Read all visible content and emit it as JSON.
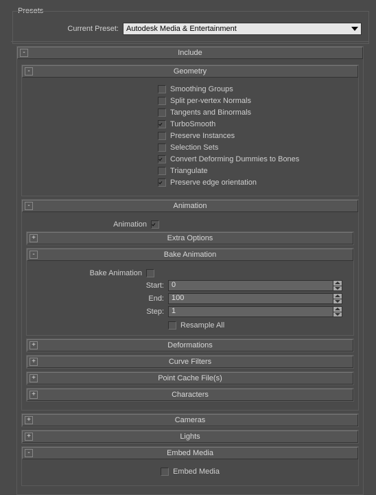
{
  "presets": {
    "legend": "Presets",
    "label": "Current Preset:",
    "value": "Autodesk Media & Entertainment"
  },
  "include": {
    "title": "Include",
    "geometry": {
      "title": "Geometry",
      "options": [
        {
          "label": "Smoothing Groups",
          "checked": false
        },
        {
          "label": "Split per-vertex Normals",
          "checked": false
        },
        {
          "label": "Tangents and Binormals",
          "checked": false
        },
        {
          "label": "TurboSmooth",
          "checked": true
        },
        {
          "label": "Preserve Instances",
          "checked": false
        },
        {
          "label": "Selection Sets",
          "checked": false
        },
        {
          "label": "Convert Deforming Dummies to Bones",
          "checked": true
        },
        {
          "label": "Triangulate",
          "checked": false
        },
        {
          "label": "Preserve edge orientation",
          "checked": true
        }
      ]
    },
    "animation": {
      "title": "Animation",
      "enable_label": "Animation",
      "enabled": true,
      "extra_options": {
        "title": "Extra Options",
        "expanded": false
      },
      "bake": {
        "title": "Bake Animation",
        "enable_label": "Bake Animation",
        "enabled": false,
        "start_label": "Start:",
        "start_value": "0",
        "end_label": "End:",
        "end_value": "100",
        "step_label": "Step:",
        "step_value": "1",
        "resample_label": "Resample All",
        "resample": false
      },
      "deformations": {
        "title": "Deformations",
        "expanded": false
      },
      "curve_filters": {
        "title": "Curve Filters",
        "expanded": false
      },
      "point_cache": {
        "title": "Point Cache File(s)",
        "expanded": false
      },
      "characters": {
        "title": "Characters",
        "expanded": false
      }
    },
    "cameras": {
      "title": "Cameras",
      "expanded": false
    },
    "lights": {
      "title": "Lights",
      "expanded": false
    },
    "embed_media": {
      "title": "Embed Media",
      "option_label": "Embed Media",
      "option_checked": false
    }
  }
}
